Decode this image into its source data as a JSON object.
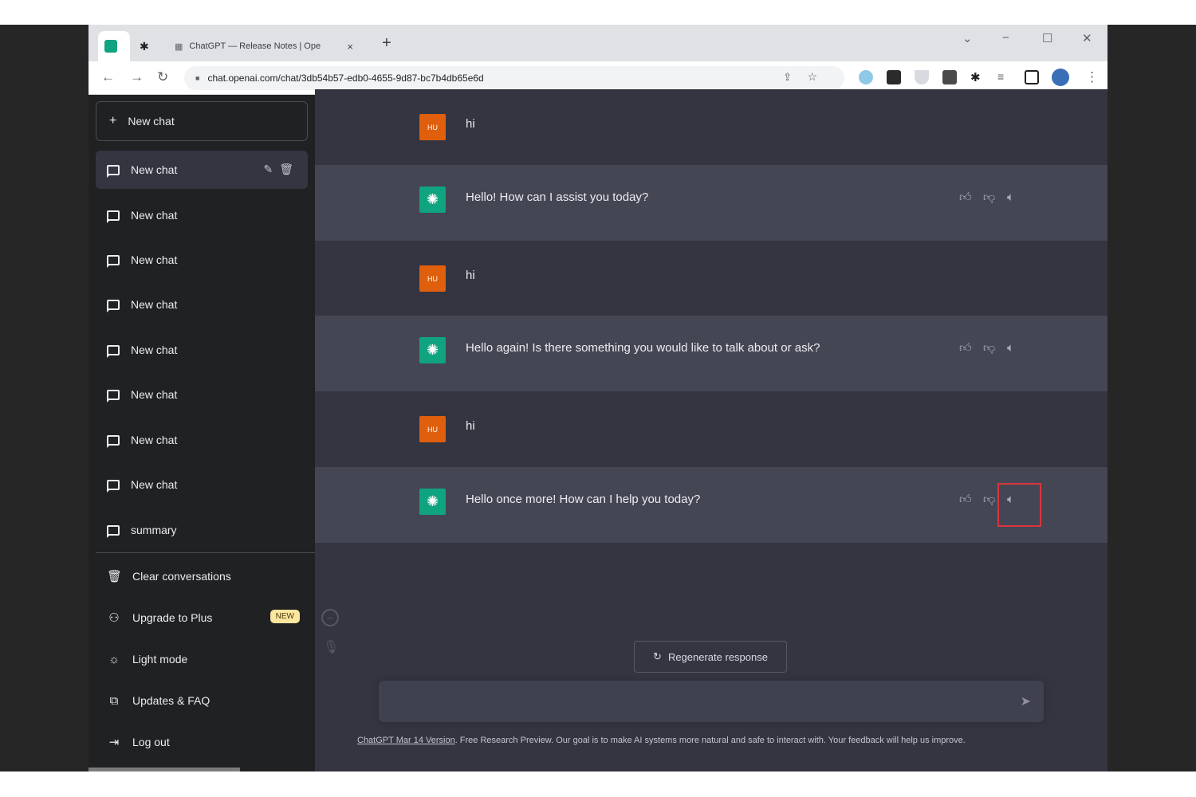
{
  "browser": {
    "tab_title": "ChatGPT — Release Notes | Ope",
    "tab_close": "×",
    "new_tab": "+",
    "url": "chat.openai.com/chat/3db54b57-edb0-4655-9d87-bc7b4db65e6d",
    "controls": {
      "minimize": "−",
      "maximize": "☐",
      "close": "✕",
      "dropdown": "⌄"
    },
    "nav": {
      "back": "←",
      "forward": "→",
      "reload": "↻",
      "lock": "🔒"
    },
    "menu": "⋮"
  },
  "sidebar": {
    "new_chat": "New chat",
    "new_chat_icon": "+",
    "conversations": [
      {
        "label": "New chat"
      },
      {
        "label": "New chat"
      },
      {
        "label": "New chat"
      },
      {
        "label": "New chat"
      },
      {
        "label": "New chat"
      },
      {
        "label": "New chat"
      },
      {
        "label": "New chat"
      },
      {
        "label": "New chat"
      },
      {
        "label": "summary"
      }
    ],
    "active_actions": "✎🗑",
    "menu": {
      "clear": "Clear conversations",
      "upgrade": "Upgrade to Plus",
      "upgrade_badge": "NEW",
      "light": "Light mode",
      "updates": "Updates & FAQ",
      "logout": "Log out"
    }
  },
  "chat": {
    "user_initials": "HU",
    "messages": [
      {
        "role": "user",
        "text": "hi"
      },
      {
        "role": "assistant",
        "text": "Hello! How can I assist you today?"
      },
      {
        "role": "user",
        "text": "hi"
      },
      {
        "role": "assistant",
        "text": "Hello again! Is there something you would like to talk about or ask?"
      },
      {
        "role": "user",
        "text": "hi"
      },
      {
        "role": "assistant",
        "text": "Hello once more! How can I help you today?"
      }
    ],
    "regenerate": "Regenerate response",
    "footer_link": "ChatGPT Mar 14 Version",
    "footer_text": ". Free Research Preview. Our goal is to make AI systems more natural and safe to interact with. Your feedback will help us improve."
  },
  "icons": {
    "thumbs_up": "thumbs-up-icon",
    "thumbs_down": "thumbs-down-icon",
    "speaker": "speaker-icon"
  },
  "colors": {
    "sidebar_bg": "#202123",
    "main_bg": "#343541",
    "assistant_bg": "#444654",
    "user_avatar": "#e05f0c",
    "assistant_avatar": "#10a37f",
    "highlight": "#d9363e"
  }
}
